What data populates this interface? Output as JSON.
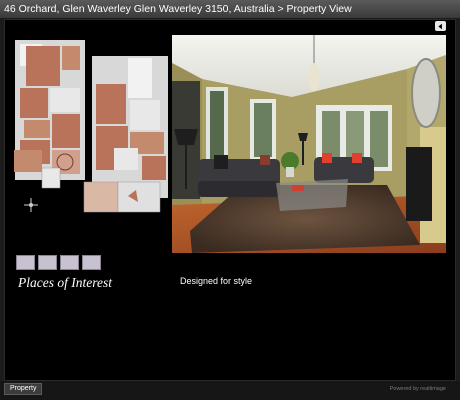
{
  "header": {
    "breadcrumb": "46 Orchard, Glen Waverley Glen Waverley 3150, Australia > Property View"
  },
  "nav": {
    "icon": "chevron-left-icon"
  },
  "poi": {
    "title": "Places of Interest",
    "thumbnail_count": 4
  },
  "photo": {
    "caption": "Designed for style",
    "subject": "living room"
  },
  "footer": {
    "tab_label": "Property",
    "credit": "Powered by realtimage"
  },
  "colors": {
    "titlebar": "#4a4a4a",
    "background": "#000000",
    "floorplan_room": "#b9735a",
    "wall": "#a89d63",
    "rug": "#5b4331",
    "floor": "#b0562a"
  }
}
